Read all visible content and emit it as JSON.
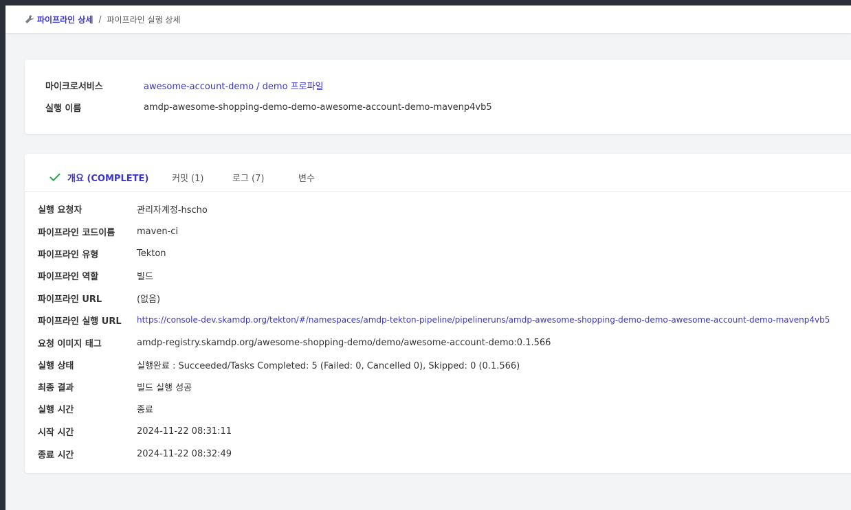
{
  "breadcrumb": {
    "parent": "파이프라인 상세",
    "separator": "/",
    "current": "파이프라인 실행 상세"
  },
  "summary": {
    "microservice_label": "마이크로서비스",
    "microservice_value": "awesome-account-demo / demo 프로파일",
    "run_name_label": "실행 이름",
    "run_name_value": "amdp-awesome-shopping-demo-demo-awesome-account-demo-mavenp4vb5"
  },
  "tabs": [
    {
      "label": "개요 (COMPLETE)",
      "active": true
    },
    {
      "label": "커밋 (1)",
      "active": false
    },
    {
      "label": "로그 (7)",
      "active": false
    },
    {
      "label": "변수",
      "active": false
    }
  ],
  "details": [
    {
      "label": "실행 요청자",
      "value": "관리자계정-hscho"
    },
    {
      "label": "파이프라인 코드이름",
      "value": "maven-ci"
    },
    {
      "label": "파이프라인 유형",
      "value": "Tekton"
    },
    {
      "label": "파이프라인 역할",
      "value": "빌드"
    },
    {
      "label": "파이프라인 URL",
      "value": "(없음)"
    },
    {
      "label": "파이프라인 실행 URL",
      "value": "https://console-dev.skamdp.org/tekton/#/namespaces/amdp-tekton-pipeline/pipelineruns/amdp-awesome-shopping-demo-demo-awesome-account-demo-mavenp4vb5"
    },
    {
      "label": "요청 이미지 태그",
      "value": "amdp-registry.skamdp.org/awesome-shopping-demo/demo/awesome-account-demo:0.1.566"
    },
    {
      "label": "실행 상태",
      "value": "실행완료 : Succeeded/Tasks Completed: 5 (Failed: 0, Cancelled 0), Skipped: 0 (0.1.566)"
    },
    {
      "label": "최종 결과",
      "value": "빌드 실행 성공"
    },
    {
      "label": "실행 시간",
      "value": "종료"
    },
    {
      "label": "시작 시간",
      "value": "2024-11-22 08:31:11"
    },
    {
      "label": "종료 시간",
      "value": "2024-11-22 08:32:49"
    }
  ],
  "colors": {
    "accent": "#3a35c8",
    "check": "#2e9e4f",
    "background": "#f3f4f6",
    "frame": "#2b2f3a"
  },
  "icons": {
    "breadcrumb": "wrench-icon",
    "tab_status": "check-icon"
  }
}
